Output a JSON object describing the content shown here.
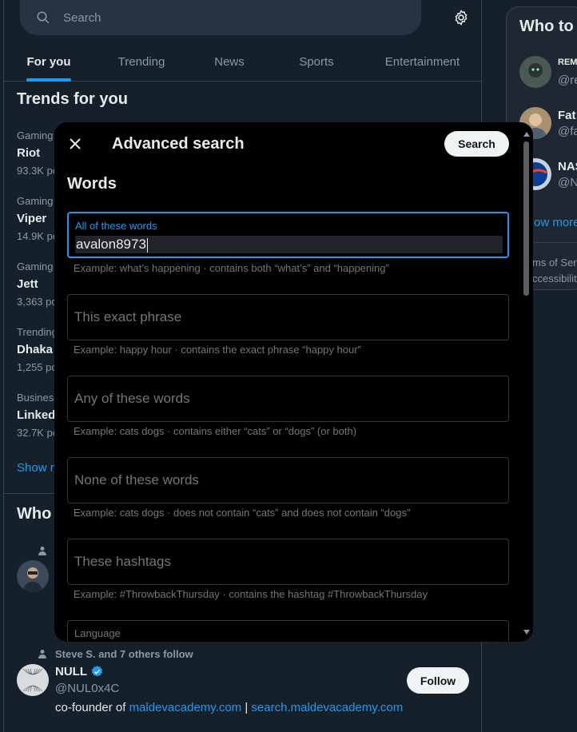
{
  "search": {
    "placeholder": "Search"
  },
  "tabs": [
    {
      "label": "For you"
    },
    {
      "label": "Trending"
    },
    {
      "label": "News"
    },
    {
      "label": "Sports"
    },
    {
      "label": "Entertainment"
    }
  ],
  "trends": {
    "title": "Trends for you",
    "items": [
      {
        "category": "Gaming",
        "name": "Riot",
        "posts": "93.3K po"
      },
      {
        "category": "Gaming",
        "name": "Viper",
        "posts": "14.9K po"
      },
      {
        "category": "Gaming",
        "name": "Jett",
        "posts": "3,363 po"
      },
      {
        "category": "Trending",
        "name": "Dhaka",
        "posts": "1,255 po"
      },
      {
        "category": "Business",
        "name": "Linked",
        "posts": "32.7K po"
      }
    ],
    "show_more": "Show m"
  },
  "who_to_follow": {
    "title": "Who",
    "follow_context": "Steve S. and 7 others follow",
    "null_user": {
      "name": "NULL",
      "handle": "@NUL0x4C",
      "bio_prefix": "co-founder of ",
      "bio_link1": "maldevacademy.com",
      "bio_sep": " | ",
      "bio_link2": "search.maldevacademy.com",
      "follow_label": "Follow"
    }
  },
  "sidebar": {
    "title": "Who to",
    "users": [
      {
        "name": "REM",
        "handle": "@re"
      },
      {
        "name": "Fat",
        "handle": "@fa"
      },
      {
        "name": "NAS",
        "handle": "@N"
      }
    ],
    "show_more": "ow more",
    "footer_1": "ms of Ser",
    "footer_2": "ccessibility"
  },
  "dialog": {
    "title": "Advanced search",
    "search_button": "Search",
    "section_words": "Words",
    "fields": {
      "all_words": {
        "label": "All of these words",
        "value": "avalon8973",
        "hint": "Example: what’s happening · contains both “what’s” and “happening”"
      },
      "exact_phrase": {
        "placeholder": "This exact phrase",
        "hint": "Example: happy hour · contains the exact phrase “happy hour”"
      },
      "any_words": {
        "placeholder": "Any of these words",
        "hint": "Example: cats dogs · contains either “cats” or “dogs” (or both)"
      },
      "none_words": {
        "placeholder": "None of these words",
        "hint": "Example: cats dogs · does not contain “cats” and does not contain “dogs”"
      },
      "hashtags": {
        "placeholder": "These hashtags",
        "hint": "Example: #ThrowbackThursday · contains the hashtag #ThrowbackThursday"
      },
      "language": {
        "label": "Language"
      }
    }
  },
  "colors": {
    "background": "#15202b",
    "accent": "#1d9bf0",
    "dialog_bg": "#000000",
    "verified": "#1d9bf0"
  }
}
